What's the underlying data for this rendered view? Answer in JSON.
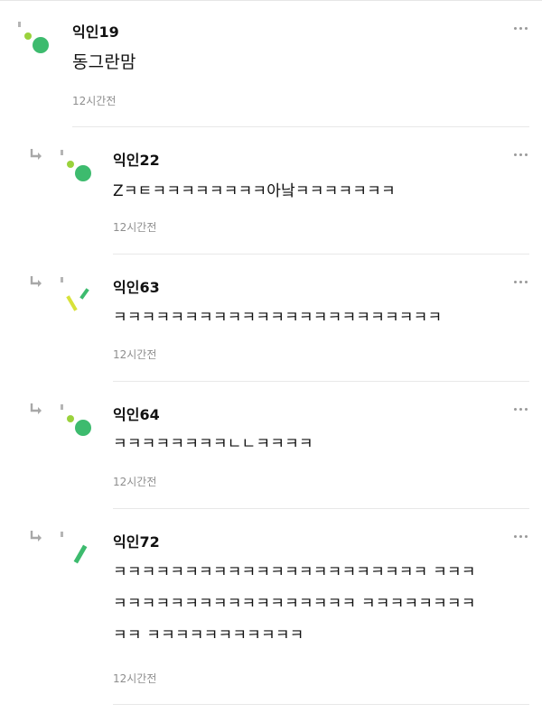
{
  "comments": [
    {
      "author": "익인19",
      "lines": [
        "동그란맘"
      ],
      "time": "12시간전",
      "avatar": "dots"
    },
    {
      "author": "익인22",
      "lines": [
        "Zㅋㅌㅋㅋㅋㅋㅋㅋㅋㅋ아낰ㅋㅋㅋㅋㅋㅋㅋ"
      ],
      "time": "12시간전",
      "avatar": "dots"
    },
    {
      "author": "익인63",
      "lines": [
        "ㅋㅋㅋㅋㅋㅋㅋㅋㅋㅋㅋㅋㅋㅋㅋㅋㅋㅋㅋㅋㅋㅋㅋ"
      ],
      "time": "12시간전",
      "avatar": "sticks"
    },
    {
      "author": "익인64",
      "lines": [
        "ㅋㅋㅋㅋㅋㅋㅋㅋㄴㄴㅋㅋㅋㅋ"
      ],
      "time": "12시간전",
      "avatar": "dots"
    },
    {
      "author": "익인72",
      "lines": [
        "ㅋㅋㅋㅋㅋㅋㅋㅋㅋㅋㅋㅋㅋㅋㅋㅋㅋㅋㅋㅋㅋㅋ ㅋㅋㅋ",
        "ㅋㅋㅋㅋㅋㅋㅋㅋㅋㅋㅋㅋㅋㅋㅋㅋㅋ ㅋㅋㅋㅋㅋㅋㅋㅋ",
        "ㅋㅋ ㅋㅋㅋㅋㅋㅋㅋㅋㅋㅋㅋ"
      ],
      "time": "12시간전",
      "avatar": "bar"
    }
  ],
  "icons": {
    "more": "more-options-icon",
    "reply": "reply-arrow-icon"
  },
  "colors": {
    "avatar_green": "#3dbb6e",
    "avatar_lime": "#9ad23c",
    "avatar_yellow": "#d8e23a",
    "time_text": "#8e8e8e",
    "divider": "#e8e8e8"
  }
}
